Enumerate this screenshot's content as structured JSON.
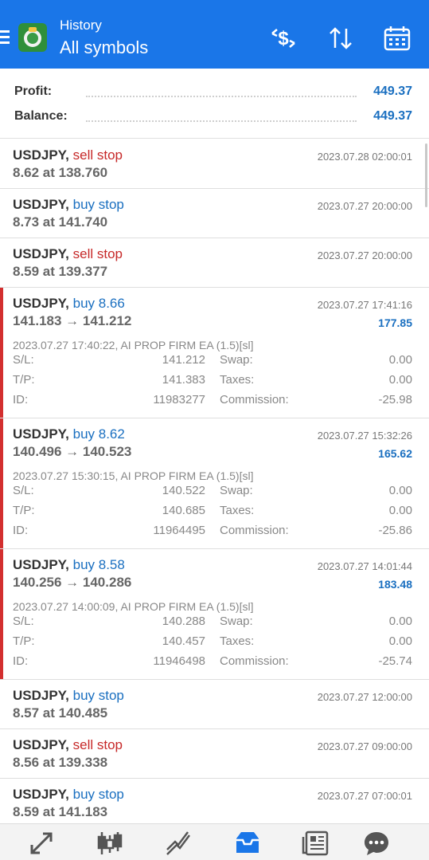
{
  "header": {
    "subtitle": "History",
    "title": "All symbols",
    "icons": [
      "menu-icon",
      "app-logo",
      "currency-exchange-icon",
      "sort-icon",
      "calendar-icon"
    ]
  },
  "summary": {
    "profit_label": "Profit:",
    "profit_value": "449.37",
    "balance_label": "Balance:",
    "balance_value": "449.37"
  },
  "items": [
    {
      "kind": "simple",
      "symbol": "USDJPY,",
      "type": "sell stop",
      "type_color": "sell",
      "line2": "8.62 at 138.760",
      "time": "2023.07.28 02:00:01"
    },
    {
      "kind": "simple",
      "symbol": "USDJPY,",
      "type": "buy stop",
      "type_color": "buy",
      "line2": "8.73 at 141.740",
      "time": "2023.07.27 20:00:00"
    },
    {
      "kind": "simple",
      "symbol": "USDJPY,",
      "type": "sell stop",
      "type_color": "sell",
      "line2": "8.59 at 139.377",
      "time": "2023.07.27 20:00:00"
    },
    {
      "kind": "deal",
      "symbol": "USDJPY,",
      "type": "buy 8.66",
      "type_color": "buy",
      "line2": "141.183 → 141.212",
      "time": "2023.07.27 17:41:16",
      "profit": "177.85",
      "comment": "2023.07.27 17:40:22, AI PROP FIRM EA (1.5)[sl]",
      "sl_label": "S/L:",
      "sl": "141.212",
      "swap_label": "Swap:",
      "swap": "0.00",
      "tp_label": "T/P:",
      "tp": "141.383",
      "taxes_label": "Taxes:",
      "taxes": "0.00",
      "id_label": "ID:",
      "id": "11983277",
      "commission_label": "Commission:",
      "commission": "-25.98"
    },
    {
      "kind": "deal",
      "symbol": "USDJPY,",
      "type": "buy 8.62",
      "type_color": "buy",
      "line2": "140.496 → 140.523",
      "time": "2023.07.27 15:32:26",
      "profit": "165.62",
      "comment": "2023.07.27 15:30:15, AI PROP FIRM EA (1.5)[sl]",
      "sl_label": "S/L:",
      "sl": "140.522",
      "swap_label": "Swap:",
      "swap": "0.00",
      "tp_label": "T/P:",
      "tp": "140.685",
      "taxes_label": "Taxes:",
      "taxes": "0.00",
      "id_label": "ID:",
      "id": "11964495",
      "commission_label": "Commission:",
      "commission": "-25.86"
    },
    {
      "kind": "deal",
      "symbol": "USDJPY,",
      "type": "buy 8.58",
      "type_color": "buy",
      "line2": "140.256 → 140.286",
      "time": "2023.07.27 14:01:44",
      "profit": "183.48",
      "comment": "2023.07.27 14:00:09, AI PROP FIRM EA (1.5)[sl]",
      "sl_label": "S/L:",
      "sl": "140.288",
      "swap_label": "Swap:",
      "swap": "0.00",
      "tp_label": "T/P:",
      "tp": "140.457",
      "taxes_label": "Taxes:",
      "taxes": "0.00",
      "id_label": "ID:",
      "id": "11946498",
      "commission_label": "Commission:",
      "commission": "-25.74"
    },
    {
      "kind": "simple",
      "symbol": "USDJPY,",
      "type": "buy stop",
      "type_color": "buy",
      "line2": "8.57 at 140.485",
      "time": "2023.07.27 12:00:00"
    },
    {
      "kind": "simple",
      "symbol": "USDJPY,",
      "type": "sell stop",
      "type_color": "sell",
      "line2": "8.56 at 139.338",
      "time": "2023.07.27 09:00:00"
    },
    {
      "kind": "simple",
      "symbol": "USDJPY,",
      "type": "buy stop",
      "type_color": "buy",
      "line2": "8.59 at 141.183",
      "time": "2023.07.27 07:00:01"
    }
  ],
  "bottom_nav": [
    "quotes-icon",
    "chart-icon",
    "trade-icon",
    "history-icon",
    "news-icon",
    "chat-icon"
  ],
  "colors": {
    "header": "#1a76e8",
    "buy": "#1a6fc0",
    "sell": "#c62828",
    "marker": "#d32f2f"
  }
}
